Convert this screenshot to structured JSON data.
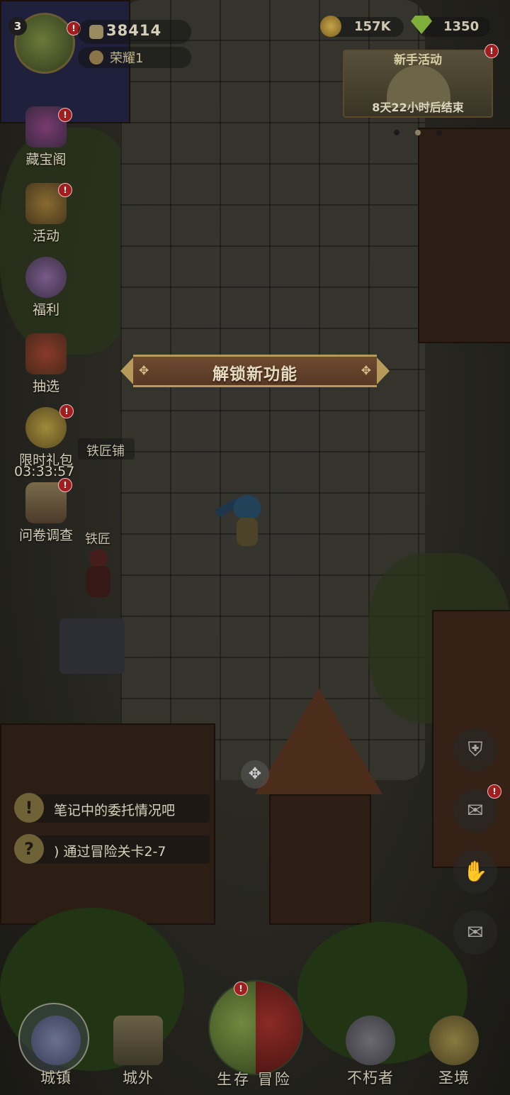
{
  "profile": {
    "level": "3",
    "power": "38414",
    "honor": "荣耀1",
    "badge": "!"
  },
  "currency": {
    "gold": "157K",
    "gems": "1350"
  },
  "event_banner": {
    "title": "新手活动",
    "timer": "8天22小时后结束",
    "badge": "!"
  },
  "side_menu": {
    "items": [
      {
        "label": "藏宝阁",
        "icon": "treasure-chest-icon",
        "badge": "!"
      },
      {
        "label": "活动",
        "icon": "event-gift-icon",
        "badge": "!"
      },
      {
        "label": "福利",
        "icon": "balloons-icon",
        "badge": ""
      },
      {
        "label": "抽选",
        "icon": "lucky-draw-icon",
        "badge": ""
      },
      {
        "label": "限时礼包",
        "icon": "limited-pack-icon",
        "badge": "!"
      },
      {
        "label": "问卷调查",
        "icon": "survey-book-icon",
        "badge": "!"
      }
    ],
    "limited_pack_timer": "03:33:57"
  },
  "unlock_banner": {
    "text": "解锁新功能"
  },
  "world_labels": {
    "blacksmith_shop": "铁匠铺",
    "blacksmith": "铁匠"
  },
  "quests": [
    {
      "icon": "!",
      "text": "笔记中的委托情况吧"
    },
    {
      "icon": "?",
      "text": ") 通过冒险关卡2-7"
    }
  ],
  "right_buttons": [
    {
      "icon": "backpack-icon",
      "glyph": "⛨"
    },
    {
      "icon": "scroll-icon",
      "glyph": "✉",
      "badge": "!"
    },
    {
      "icon": "handshake-icon",
      "glyph": "✋"
    },
    {
      "icon": "mail-icon",
      "glyph": "✉"
    }
  ],
  "bottom_nav": {
    "town": "城镇",
    "outside": "城外",
    "survival": "生存",
    "adventure": "冒险",
    "immortal": "不朽者",
    "sanctuary": "圣境",
    "center_badge": "!"
  },
  "colors": {
    "accent_gold": "#b69a5a",
    "badge_red": "#a21e1e",
    "banner_brown": "#6e4a30"
  }
}
